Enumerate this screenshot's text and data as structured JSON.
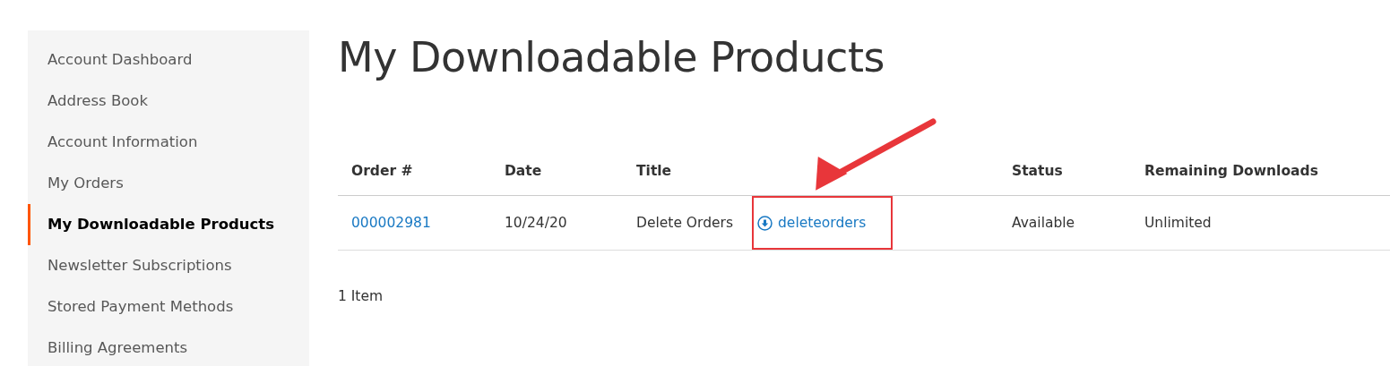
{
  "sidebar": {
    "items": [
      {
        "label": "Account Dashboard",
        "selected": false
      },
      {
        "label": "Address Book",
        "selected": false
      },
      {
        "label": "Account Information",
        "selected": false
      },
      {
        "label": "My Orders",
        "selected": false
      },
      {
        "label": "My Downloadable Products",
        "selected": true
      },
      {
        "label": "Newsletter Subscriptions",
        "selected": false
      },
      {
        "label": "Stored Payment Methods",
        "selected": false
      },
      {
        "label": "Billing Agreements",
        "selected": false
      }
    ]
  },
  "page_title": "My Downloadable Products",
  "table": {
    "columns": [
      "Order #",
      "Date",
      "Title",
      null,
      "Status",
      "Remaining Downloads"
    ],
    "rows": [
      {
        "cells": [
          {
            "kind": "link",
            "text": "000002981"
          },
          {
            "kind": "text",
            "text": "10/24/20"
          },
          {
            "kind": "text",
            "text": "Delete Orders"
          },
          {
            "kind": "download",
            "text": "deleteorders"
          },
          {
            "kind": "text",
            "text": "Available"
          },
          {
            "kind": "text",
            "text": "Unlimited"
          }
        ]
      }
    ]
  },
  "item_count": "1 Item"
}
